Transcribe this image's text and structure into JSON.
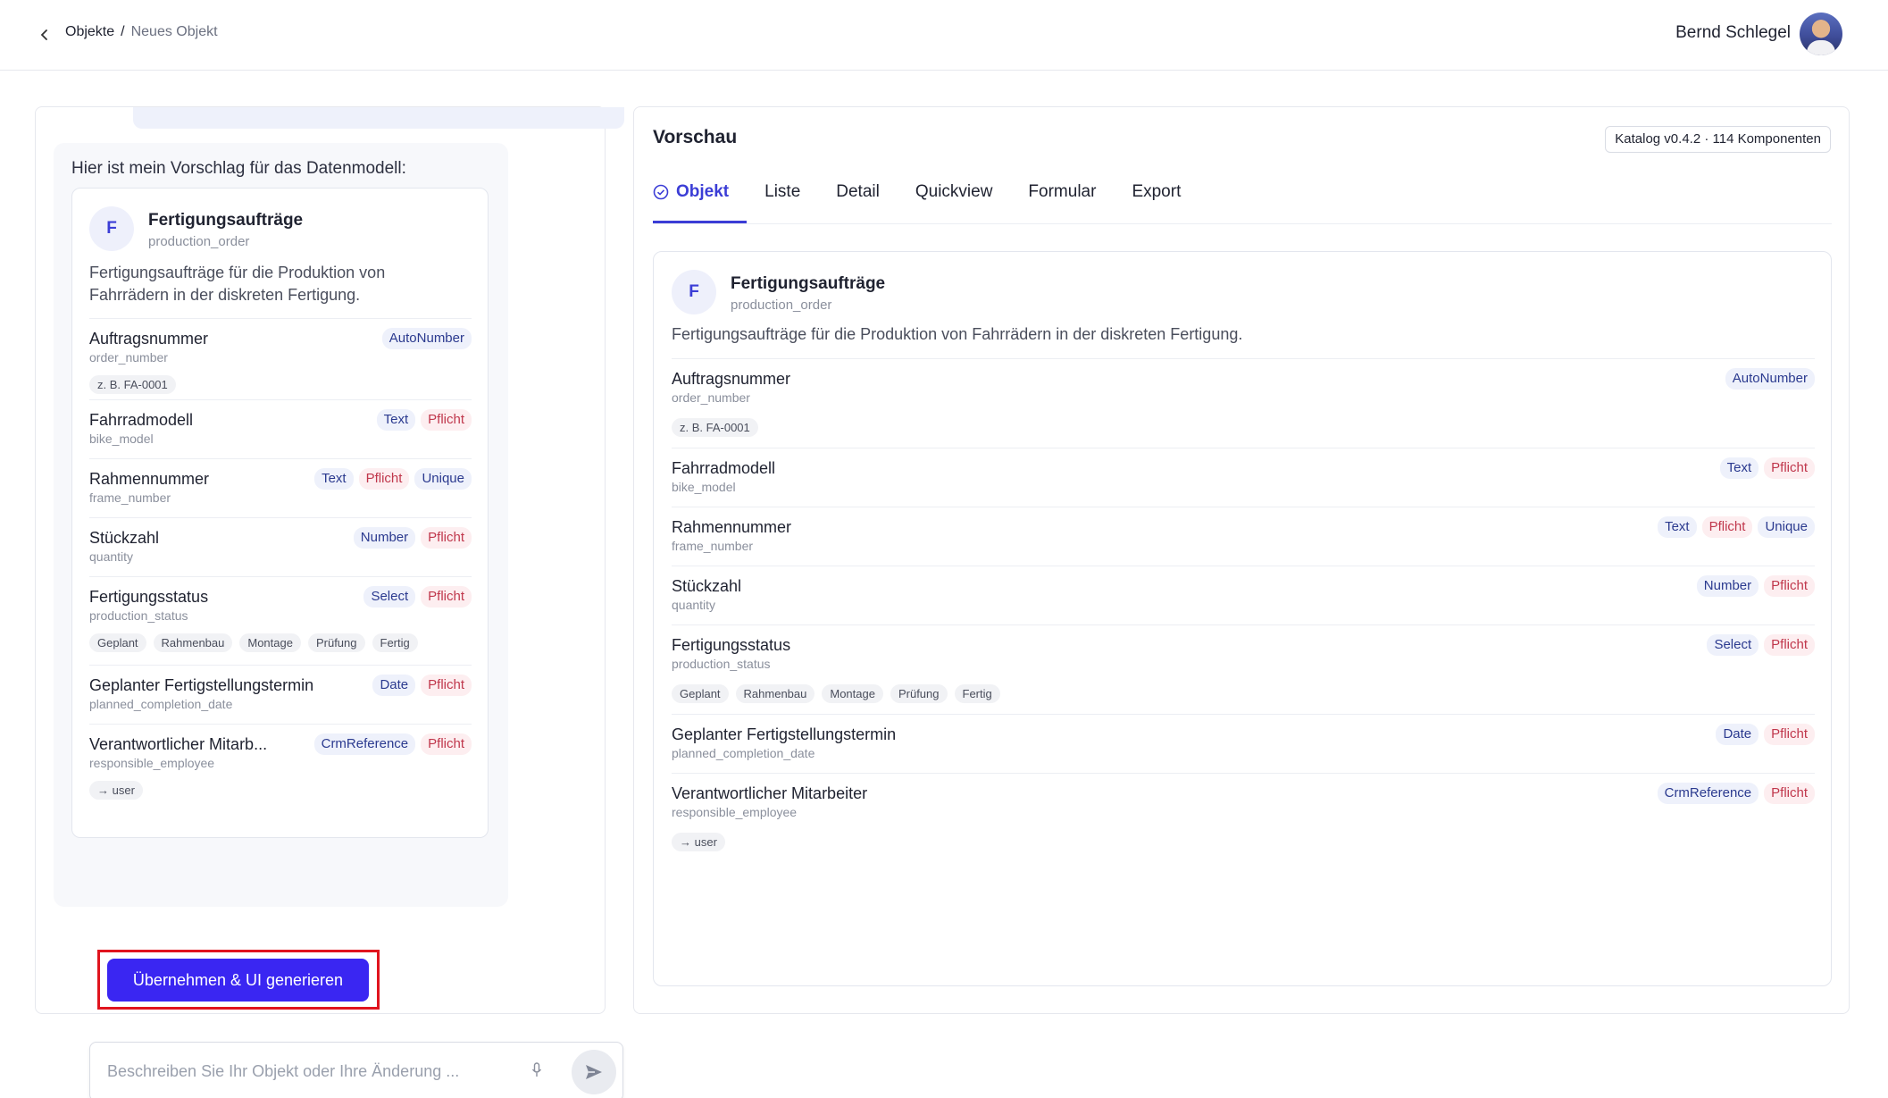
{
  "header": {
    "breadcrumb_parent": "Objekte",
    "breadcrumb_sep": "/",
    "breadcrumb_current": "Neues Objekt",
    "user_name": "Bernd Schlegel"
  },
  "chat": {
    "intro": "Hier ist mein Vorschlag für das Datenmodell:",
    "apply_label": "Übernehmen & UI generieren",
    "input_placeholder": "Beschreiben Sie Ihr Objekt oder Ihre Änderung ..."
  },
  "model": {
    "initial": "F",
    "title": "Fertigungsaufträge",
    "key": "production_order",
    "description": "Fertigungsaufträge für die Produktion von Fahrrädern in der diskreten Fertigung.",
    "fields": [
      {
        "name": "Auftragsnummer",
        "short_name": "Auftragsnummer",
        "key": "order_number",
        "badges": [
          "AutoNumber"
        ],
        "chips": [
          "z. B. FA-0001"
        ]
      },
      {
        "name": "Fahrradmodell",
        "short_name": "Fahrradmodell",
        "key": "bike_model",
        "badges": [
          "Text",
          "Pflicht"
        ],
        "chips": []
      },
      {
        "name": "Rahmennummer",
        "short_name": "Rahmennummer",
        "key": "frame_number",
        "badges": [
          "Text",
          "Pflicht",
          "Unique"
        ],
        "chips": []
      },
      {
        "name": "Stückzahl",
        "short_name": "Stückzahl",
        "key": "quantity",
        "badges": [
          "Number",
          "Pflicht"
        ],
        "chips": []
      },
      {
        "name": "Fertigungsstatus",
        "short_name": "Fertigungsstatus",
        "key": "production_status",
        "badges": [
          "Select",
          "Pflicht"
        ],
        "chips": [
          "Geplant",
          "Rahmenbau",
          "Montage",
          "Prüfung",
          "Fertig"
        ]
      },
      {
        "name": "Geplanter Fertigstellungstermin",
        "short_name": "Geplanter Fertigstellungstermin",
        "key": "planned_completion_date",
        "badges": [
          "Date",
          "Pflicht"
        ],
        "chips": []
      },
      {
        "name": "Verantwortlicher Mitarbeiter",
        "short_name": "Verantwortlicher Mitarb...",
        "key": "responsible_employee",
        "badges": [
          "CrmReference",
          "Pflicht"
        ],
        "chips": [
          "→ user"
        ]
      }
    ]
  },
  "preview": {
    "title": "Vorschau",
    "catalog": "Katalog v0.4.2 · 114 Komponenten",
    "tabs": [
      "Objekt",
      "Liste",
      "Detail",
      "Quickview",
      "Formular",
      "Export"
    ],
    "active_tab": "Objekt"
  },
  "colors": {
    "accent": "#3a26f2",
    "highlight": "#e0141e",
    "badge_blue_bg": "#eef1fb",
    "badge_red_bg": "#fdeef0"
  }
}
